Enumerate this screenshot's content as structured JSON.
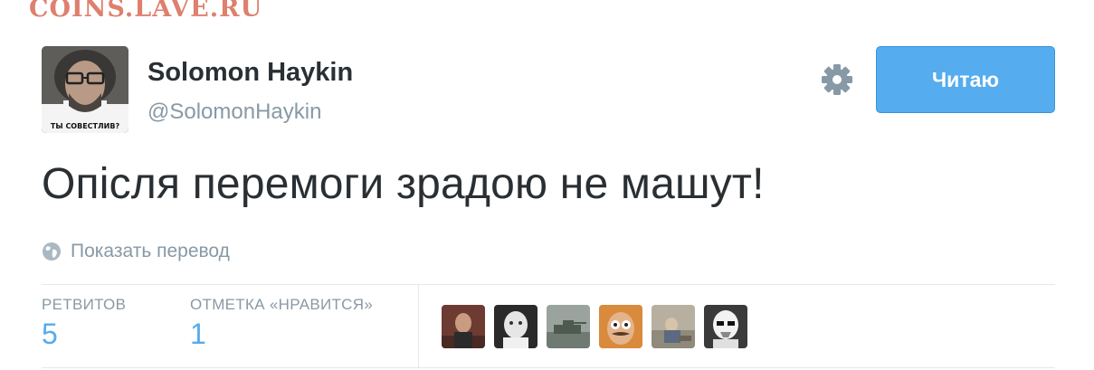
{
  "watermark": "COINS.LAVE.RU",
  "user": {
    "display_name": "Solomon Haykin",
    "handle": "@SolomonHaykin",
    "avatar_caption": "ТЫ СОВЕСТЛИВ?"
  },
  "actions": {
    "settings_icon": "gear-icon",
    "follow_label": "Читаю"
  },
  "tweet": {
    "text": "Опісля перемоги зрадою не машут!",
    "translate_icon": "globe-icon",
    "translate_label": "Показать перевод"
  },
  "stats": {
    "retweets_label": "РЕТВИТОВ",
    "retweets_value": "5",
    "likes_label": "ОТМЕТКА «НРАВИТСЯ»",
    "likes_value": "1"
  },
  "colors": {
    "accent": "#55acee",
    "text": "#292f33",
    "muted": "#8899a6",
    "divider": "#e1e8ed",
    "watermark": "#d96a55"
  }
}
